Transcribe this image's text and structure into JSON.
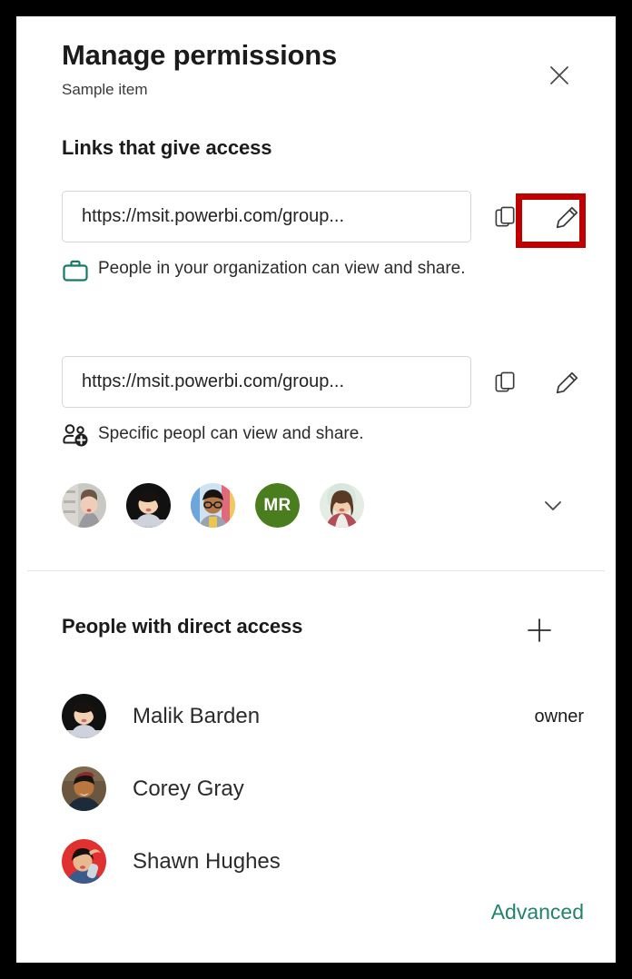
{
  "dialog": {
    "title": "Manage permissions",
    "subtitle": "Sample item",
    "close_label": "Close"
  },
  "links_section": {
    "title": "Links that give access",
    "links": [
      {
        "url": "https://msit.powerbi.com/group...",
        "description": "People in your organization can view and share.",
        "scope_icon": "briefcase-icon",
        "scope_icon_color": "#147a68",
        "copy_icon": "copy-icon",
        "edit_icon": "pencil-edit-icon",
        "highlighted": true
      },
      {
        "url": "https://msit.powerbi.com/group...",
        "description": "Specific peopl can view and share.",
        "scope_icon": "people-add-icon",
        "scope_icon_color": "#1f1f1f",
        "copy_icon": "copy-icon",
        "edit_icon": "pencil-edit-icon",
        "highlighted": false
      }
    ],
    "avatars": [
      {
        "type": "photo",
        "alt": "person-avatar-1"
      },
      {
        "type": "photo",
        "alt": "person-avatar-2"
      },
      {
        "type": "photo",
        "alt": "person-avatar-3"
      },
      {
        "type": "initials",
        "initials": "MR",
        "color": "#4a7d1e"
      },
      {
        "type": "photo",
        "alt": "person-avatar-5"
      }
    ],
    "expand_icon": "chevron-down-icon"
  },
  "direct_access_section": {
    "title": "People with direct access",
    "add_icon": "plus-icon",
    "people": [
      {
        "name": "Malik Barden",
        "role": "owner"
      },
      {
        "name": "Corey Gray",
        "role": ""
      },
      {
        "name": "Shawn Hughes",
        "role": ""
      }
    ]
  },
  "footer": {
    "advanced_label": "Advanced",
    "advanced_color": "#23826e"
  },
  "highlight": {
    "color": "#c00000"
  }
}
